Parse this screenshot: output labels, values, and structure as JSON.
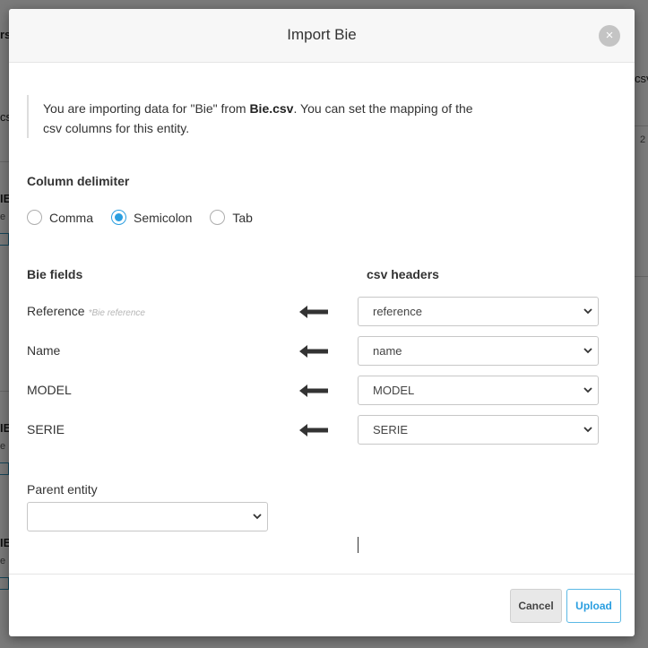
{
  "background": {
    "fragments": [
      "rs",
      "cs",
      "IE",
      "e",
      "IE",
      "e",
      "IE",
      "e",
      "csv",
      "2"
    ]
  },
  "modal": {
    "title": "Import Bie",
    "close_glyph": "×",
    "info": {
      "prefix": "You are importing data for \"Bie\" from ",
      "filename": "Bie.csv",
      "suffix": ". You can set the mapping of the csv columns for this entity."
    },
    "delimiter": {
      "label": "Column delimiter",
      "options": [
        "Comma",
        "Semicolon",
        "Tab"
      ],
      "selected": "Semicolon"
    },
    "mapping": {
      "fields_header": "Bie fields",
      "csv_header": "csv headers",
      "rows": [
        {
          "field": "Reference",
          "hint": "*Bie reference",
          "value": "reference"
        },
        {
          "field": "Name",
          "hint": "",
          "value": "name"
        },
        {
          "field": "MODEL",
          "hint": "",
          "value": "MODEL"
        },
        {
          "field": "SERIE",
          "hint": "",
          "value": "SERIE"
        }
      ]
    },
    "parent": {
      "label": "Parent entity",
      "value": ""
    },
    "footer": {
      "cancel_label": "Cancel",
      "upload_label": "Upload"
    }
  },
  "icons": {
    "arrow": "arrow-left-icon",
    "chevron": "chevron-down-icon",
    "close": "close-icon"
  },
  "colors": {
    "accent": "#2a9ee0",
    "upload_border": "#5bb9e5"
  }
}
